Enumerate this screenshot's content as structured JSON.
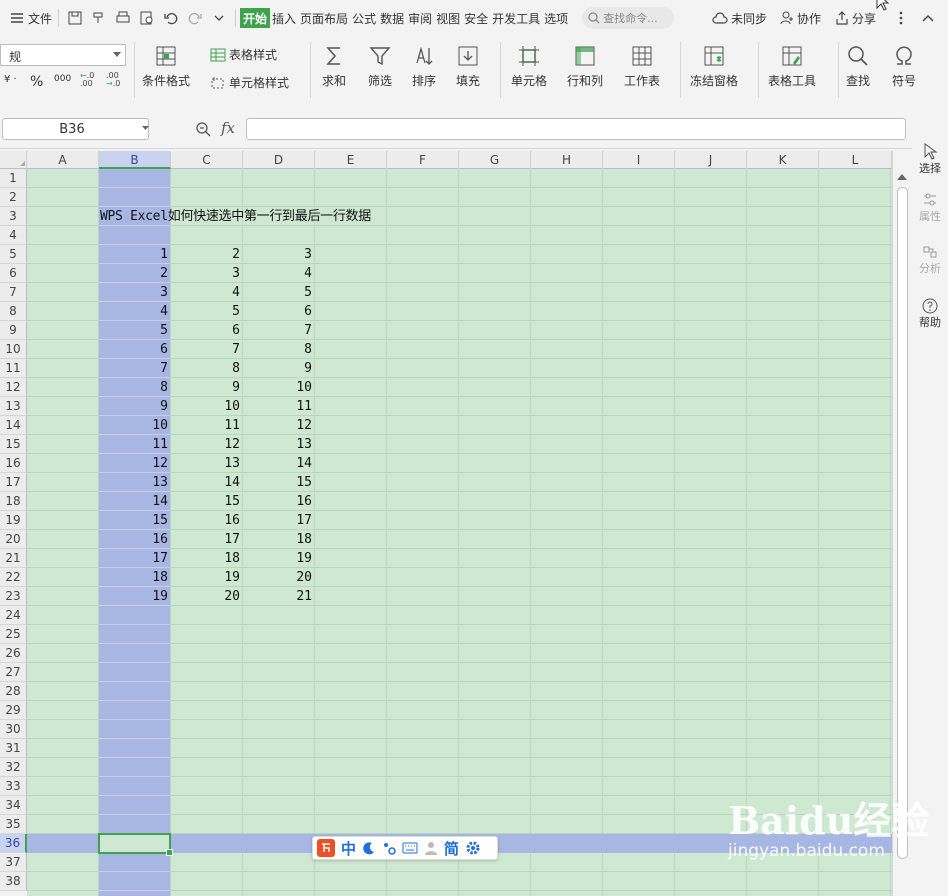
{
  "menu": {
    "file_label": "文件",
    "tabs": [
      "开始",
      "插入",
      "页面布局",
      "公式",
      "数据",
      "审阅",
      "视图",
      "安全",
      "开发工具",
      "选项"
    ],
    "active_tab": "开始",
    "search_placeholder": "查找命令...",
    "right": {
      "sync_label": "未同步",
      "collab_label": "协作",
      "share_label": "分享"
    }
  },
  "ribbon": {
    "number_format": "规",
    "percent": "%",
    "thousands": "000",
    "groups": {
      "cond_format": "条件格式",
      "table_style": "表格样式",
      "cell_style": "单元格样式",
      "sum": "求和",
      "filter": "筛选",
      "sort": "排序",
      "fill": "填充",
      "cell": "单元格",
      "row_col": "行和列",
      "sheet": "工作表",
      "freeze": "冻结窗格",
      "table_tools": "表格工具",
      "find": "查找",
      "symbol": "符号"
    }
  },
  "formula_bar": {
    "name_box": "B36",
    "fx": "fx",
    "formula": ""
  },
  "sheet": {
    "columns": [
      "A",
      "B",
      "C",
      "D",
      "E",
      "F",
      "G",
      "H",
      "I",
      "J",
      "K",
      "L"
    ],
    "selected_column": "B",
    "rows": [
      "1",
      "2",
      "3",
      "4",
      "5",
      "6",
      "7",
      "8",
      "9",
      "10",
      "11",
      "12",
      "13",
      "14",
      "15",
      "16",
      "17",
      "18",
      "19",
      "20",
      "21",
      "22",
      "23",
      "24",
      "25",
      "26",
      "27",
      "28",
      "29",
      "30",
      "31",
      "32",
      "33",
      "34",
      "35",
      "36",
      "37",
      "38"
    ],
    "active_row": "36",
    "title_cell": "WPS Excel如何快速选中第一行到最后一行数据",
    "data_rows": [
      [
        "1",
        "2",
        "3"
      ],
      [
        "2",
        "3",
        "4"
      ],
      [
        "3",
        "4",
        "5"
      ],
      [
        "4",
        "5",
        "6"
      ],
      [
        "5",
        "6",
        "7"
      ],
      [
        "6",
        "7",
        "8"
      ],
      [
        "7",
        "8",
        "9"
      ],
      [
        "8",
        "9",
        "10"
      ],
      [
        "9",
        "10",
        "11"
      ],
      [
        "10",
        "11",
        "12"
      ],
      [
        "11",
        "12",
        "13"
      ],
      [
        "12",
        "13",
        "14"
      ],
      [
        "13",
        "14",
        "15"
      ],
      [
        "14",
        "15",
        "16"
      ],
      [
        "15",
        "16",
        "17"
      ],
      [
        "16",
        "17",
        "18"
      ],
      [
        "17",
        "18",
        "19"
      ],
      [
        "18",
        "19",
        "20"
      ],
      [
        "19",
        "20",
        "21"
      ]
    ]
  },
  "side_panel": {
    "select": "选择",
    "properties": "属性",
    "analysis": "分析",
    "help": "帮助"
  },
  "ime": {
    "chinese": "中",
    "simplified": "简"
  },
  "watermark": {
    "brand": "Baidu经验",
    "url": "jingyan.baidu.com"
  },
  "colors": {
    "accent": "#3fa34d",
    "selection": "#a8b6e3",
    "cell_bg": "#cfe8d1"
  }
}
